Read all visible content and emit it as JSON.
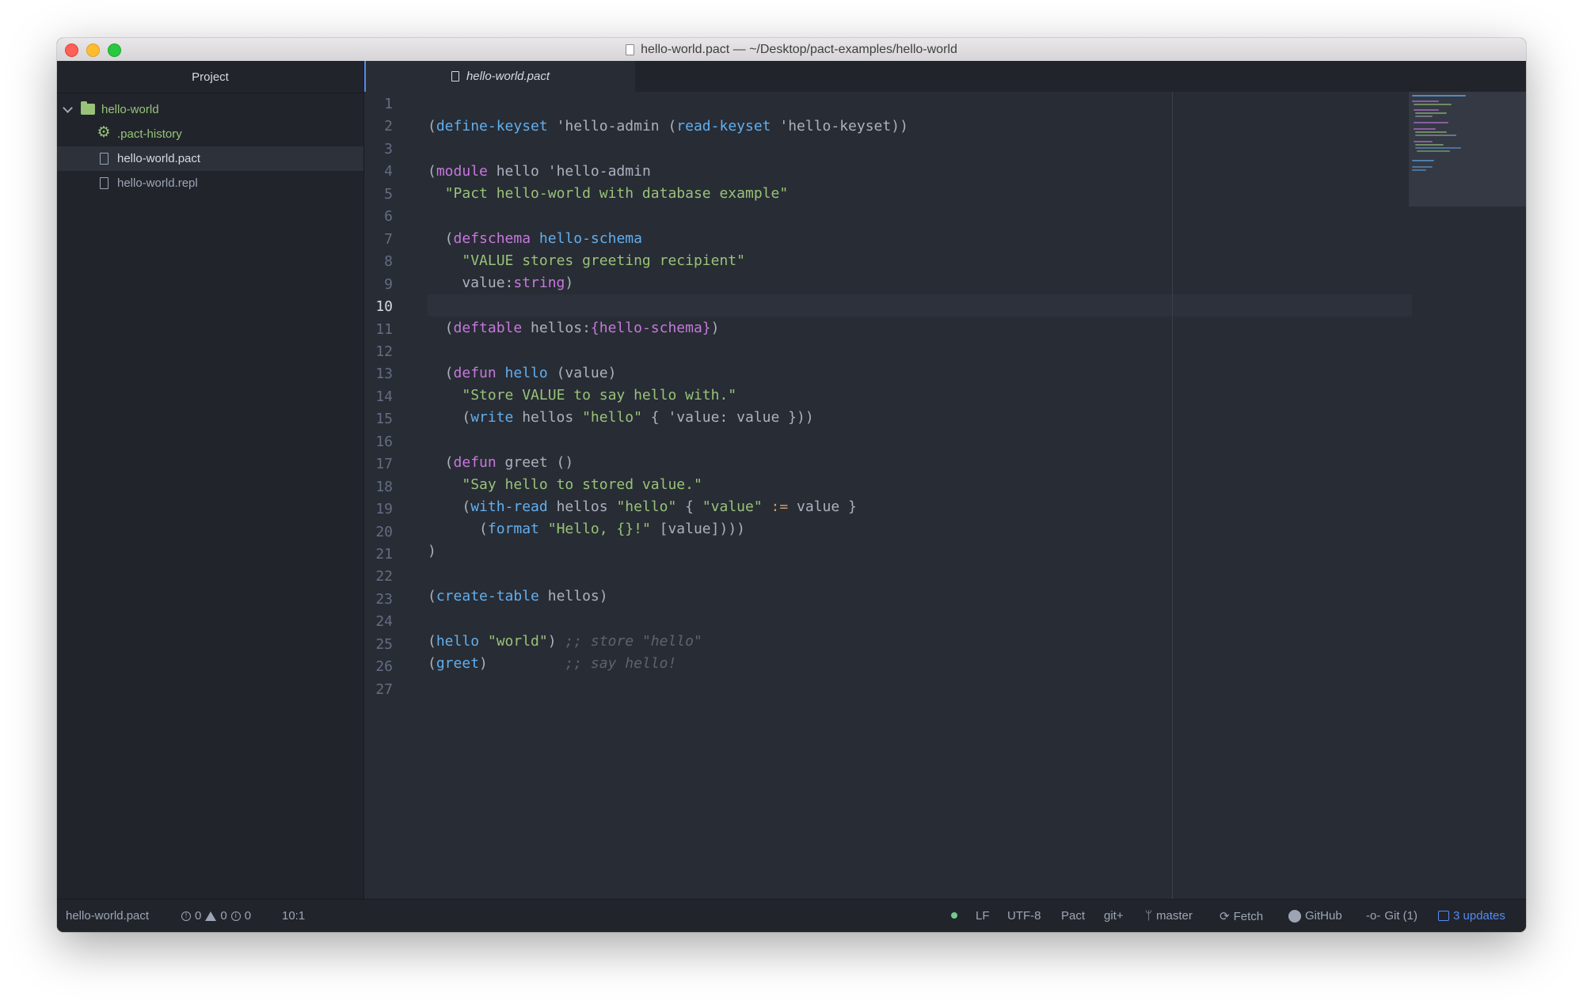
{
  "window": {
    "title": "hello-world.pact — ~/Desktop/pact-examples/hello-world"
  },
  "sidebar": {
    "header": "Project",
    "root_folder": "hello-world",
    "items": [
      {
        "label": ".pact-history",
        "icon": "gear-icon"
      },
      {
        "label": "hello-world.pact",
        "icon": "file-icon",
        "selected": true
      },
      {
        "label": "hello-world.repl",
        "icon": "file-icon"
      }
    ]
  },
  "tab": {
    "label": "hello-world.pact"
  },
  "editor": {
    "active_line": 10,
    "line_numbers": [
      "1",
      "2",
      "3",
      "4",
      "5",
      "6",
      "7",
      "8",
      "9",
      "10",
      "11",
      "12",
      "13",
      "14",
      "15",
      "16",
      "17",
      "18",
      "19",
      "20",
      "21",
      "22",
      "23",
      "24",
      "25",
      "26",
      "27"
    ]
  },
  "status": {
    "file": "hello-world.pact",
    "errors": "0",
    "warnings": "0",
    "infos": "0",
    "cursor": "10:1",
    "line_ending": "LF",
    "encoding": "UTF-8",
    "grammar": "Pact",
    "git_status": "git+",
    "branch": "master",
    "fetch": "Fetch",
    "github": "GitHub",
    "git": "Git (1)",
    "updates": "3 updates"
  },
  "colors": {
    "accent": "#568af2",
    "keyword": "#c678dd",
    "function": "#61afef",
    "string": "#98c379",
    "comment": "#5c6370"
  }
}
